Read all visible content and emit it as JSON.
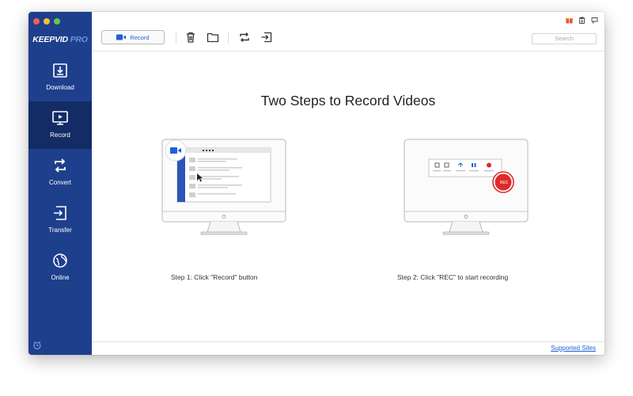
{
  "app": {
    "logo_main": "KEEPVID",
    "logo_suffix": "PRO",
    "traffic_colors": [
      "#ee5f57",
      "#f6bd3b",
      "#62c554"
    ]
  },
  "sidebar": {
    "items": [
      {
        "label": "Download",
        "icon": "download-icon"
      },
      {
        "label": "Record",
        "icon": "record-icon"
      },
      {
        "label": "Convert",
        "icon": "convert-icon"
      },
      {
        "label": "Transfer",
        "icon": "transfer-icon"
      },
      {
        "label": "Online",
        "icon": "globe-icon"
      }
    ],
    "active": "Record"
  },
  "toolbar": {
    "record_label": "Record",
    "search_placeholder": "Search"
  },
  "main": {
    "title": "Two Steps to Record Videos",
    "step1": "Step 1: Click \"Record\" button",
    "step2": "Step 2: Click \"REC\" to start recording",
    "rec_label": "REC"
  },
  "footer": {
    "supported_sites": "Supported Sites"
  },
  "colors": {
    "sidebar": "#1e3f8c",
    "sidebar_active": "#132c66",
    "accent": "#1e5fd6",
    "rec_red": "#e02a2a"
  }
}
